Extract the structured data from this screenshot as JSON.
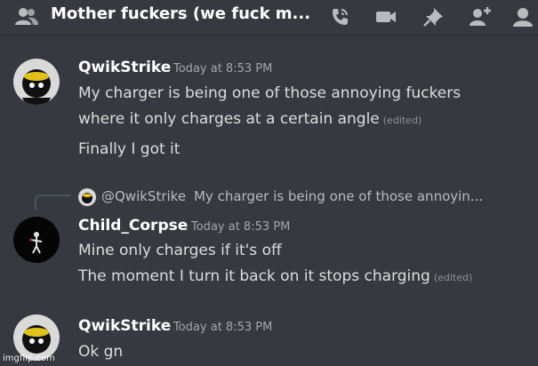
{
  "channel": {
    "title": "Mother fuckers (we fuck m...",
    "icons": [
      "people-icon",
      "call-icon",
      "video-icon",
      "pin-icon",
      "add-member-icon",
      "profile-icon"
    ]
  },
  "messages": [
    {
      "author": "QwikStrike",
      "timestamp": "Today at 8:53 PM",
      "lines": [
        {
          "text": "My charger is being one of those annoying fuckers"
        },
        {
          "text": "where it only charges at a certain angle",
          "edited": "(edited)"
        },
        {
          "text": "Finally I got it"
        }
      ]
    },
    {
      "reply": {
        "mention": "@QwikStrike",
        "text": "My charger is being one of those annoyin..."
      },
      "author": "Child_Corpse",
      "timestamp": "Today at 8:53 PM",
      "lines": [
        {
          "text": "Mine only charges if it's off"
        },
        {
          "text": "The moment I turn it back on it stops charging",
          "edited": "(edited)"
        }
      ]
    },
    {
      "author": "QwikStrike",
      "timestamp": "Today at 8:53 PM",
      "lines": [
        {
          "text": "Ok gn"
        }
      ]
    }
  ],
  "watermark": "imgflip.com",
  "colors": {
    "background": "#36393f",
    "username": "#ffffff",
    "text": "#dcddde",
    "muted": "#a3a6aa"
  }
}
